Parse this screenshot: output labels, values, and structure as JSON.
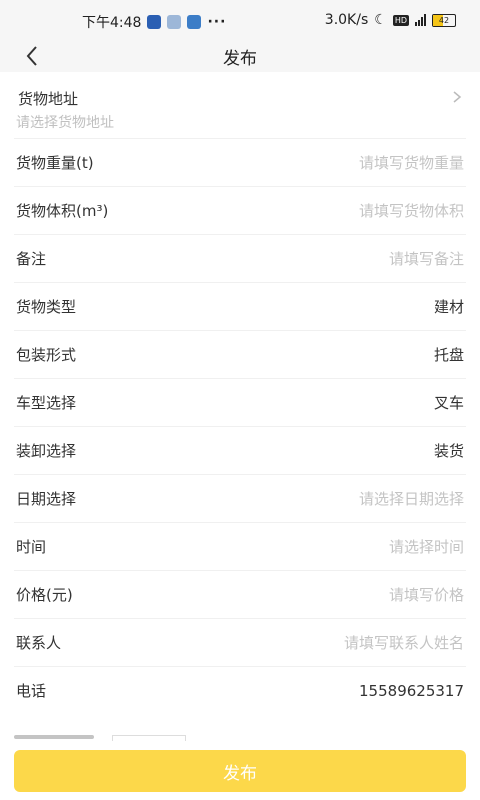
{
  "status_bar": {
    "time": "下午4:48",
    "more": "···",
    "net_speed": "3.0K/s",
    "hd": "HD",
    "battery": "42",
    "colors": {
      "battery_fill": "#f5c518"
    }
  },
  "header": {
    "title": "发布",
    "back_icon": "chevron-left-icon"
  },
  "form": {
    "address": {
      "label": "货物地址",
      "placeholder": "请选择货物地址"
    },
    "weight": {
      "label": "货物重量(t)",
      "placeholder": "请填写货物重量"
    },
    "volume": {
      "label": "货物体积(m³)",
      "placeholder": "请填写货物体积"
    },
    "remark": {
      "label": "备注",
      "placeholder": "请填写备注"
    },
    "cargo_type": {
      "label": "货物类型",
      "value": "建材"
    },
    "packaging": {
      "label": "包装形式",
      "value": "托盘"
    },
    "vehicle": {
      "label": "车型选择",
      "value": "叉车"
    },
    "load_unload": {
      "label": "装卸选择",
      "value": "装货"
    },
    "date": {
      "label": "日期选择",
      "placeholder": "请选择日期选择"
    },
    "time": {
      "label": "时间",
      "placeholder": "请选择时间"
    },
    "price": {
      "label": "价格(元)",
      "placeholder": "请填写价格"
    },
    "contact": {
      "label": "联系人",
      "placeholder": "请填写联系人姓名"
    },
    "phone": {
      "label": "电话",
      "value": "15589625317"
    }
  },
  "publish_button": {
    "label": "发布",
    "color": "#fcd84a"
  }
}
